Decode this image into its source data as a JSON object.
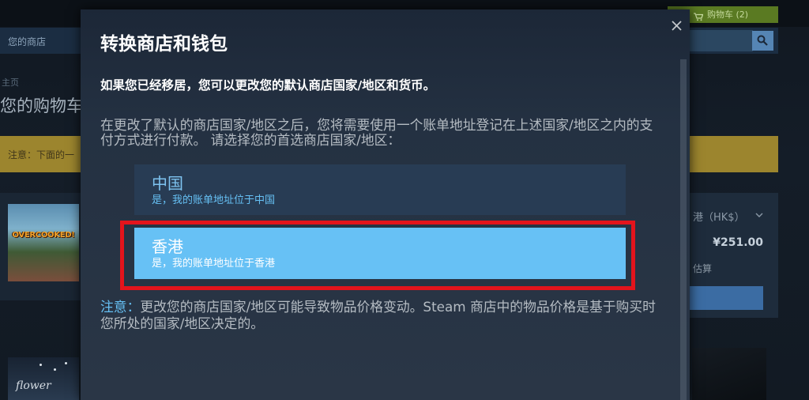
{
  "colors": {
    "accent": "#66c0f4",
    "selected_option": "#67c1f5",
    "highlight": "#e3141c",
    "cart_green": "#5a7a22",
    "notice_yellow": "#9c852e"
  },
  "background": {
    "cart_button": {
      "label": "购物车 (2)",
      "icon": "cart-icon"
    },
    "store_nav": {
      "items": [
        "您的商店"
      ]
    },
    "search": {
      "icon": "search-icon"
    },
    "breadcrumb": "主页",
    "page_title": "您的购物车",
    "notice": "注意：下面的一",
    "cart_item": {
      "thumbnail_logo": "OVERCOOKED!"
    },
    "summary": {
      "currency": "港（HK$）",
      "currency_icon": "chevron-down-icon",
      "price": "¥251.00",
      "estimate_label": "估算"
    },
    "next_item": {
      "thumbnail_logo": "flower"
    }
  },
  "modal": {
    "title": "转换商店和钱包",
    "close_icon": "close-icon",
    "intro": "如果您已经移居，您可以更改您的默认商店国家/地区和货币。",
    "instructions": "在更改了默认的商店国家/地区之后，您将需要使用一个账单地址登记在上述国家/地区之内的支付方式进行付款。 请选择您的首选商店国家/地区：",
    "options": [
      {
        "name": "中国",
        "description": "是，我的账单地址位于中国",
        "selected": false
      },
      {
        "name": "香港",
        "description": "是，我的账单地址位于香港",
        "selected": true
      }
    ],
    "note": {
      "label": "注意：",
      "text": "更改您的商店国家/地区可能导致物品价格变动。Steam 商店中的物品价格是基于购买时您所处的国家/地区决定的。"
    }
  }
}
